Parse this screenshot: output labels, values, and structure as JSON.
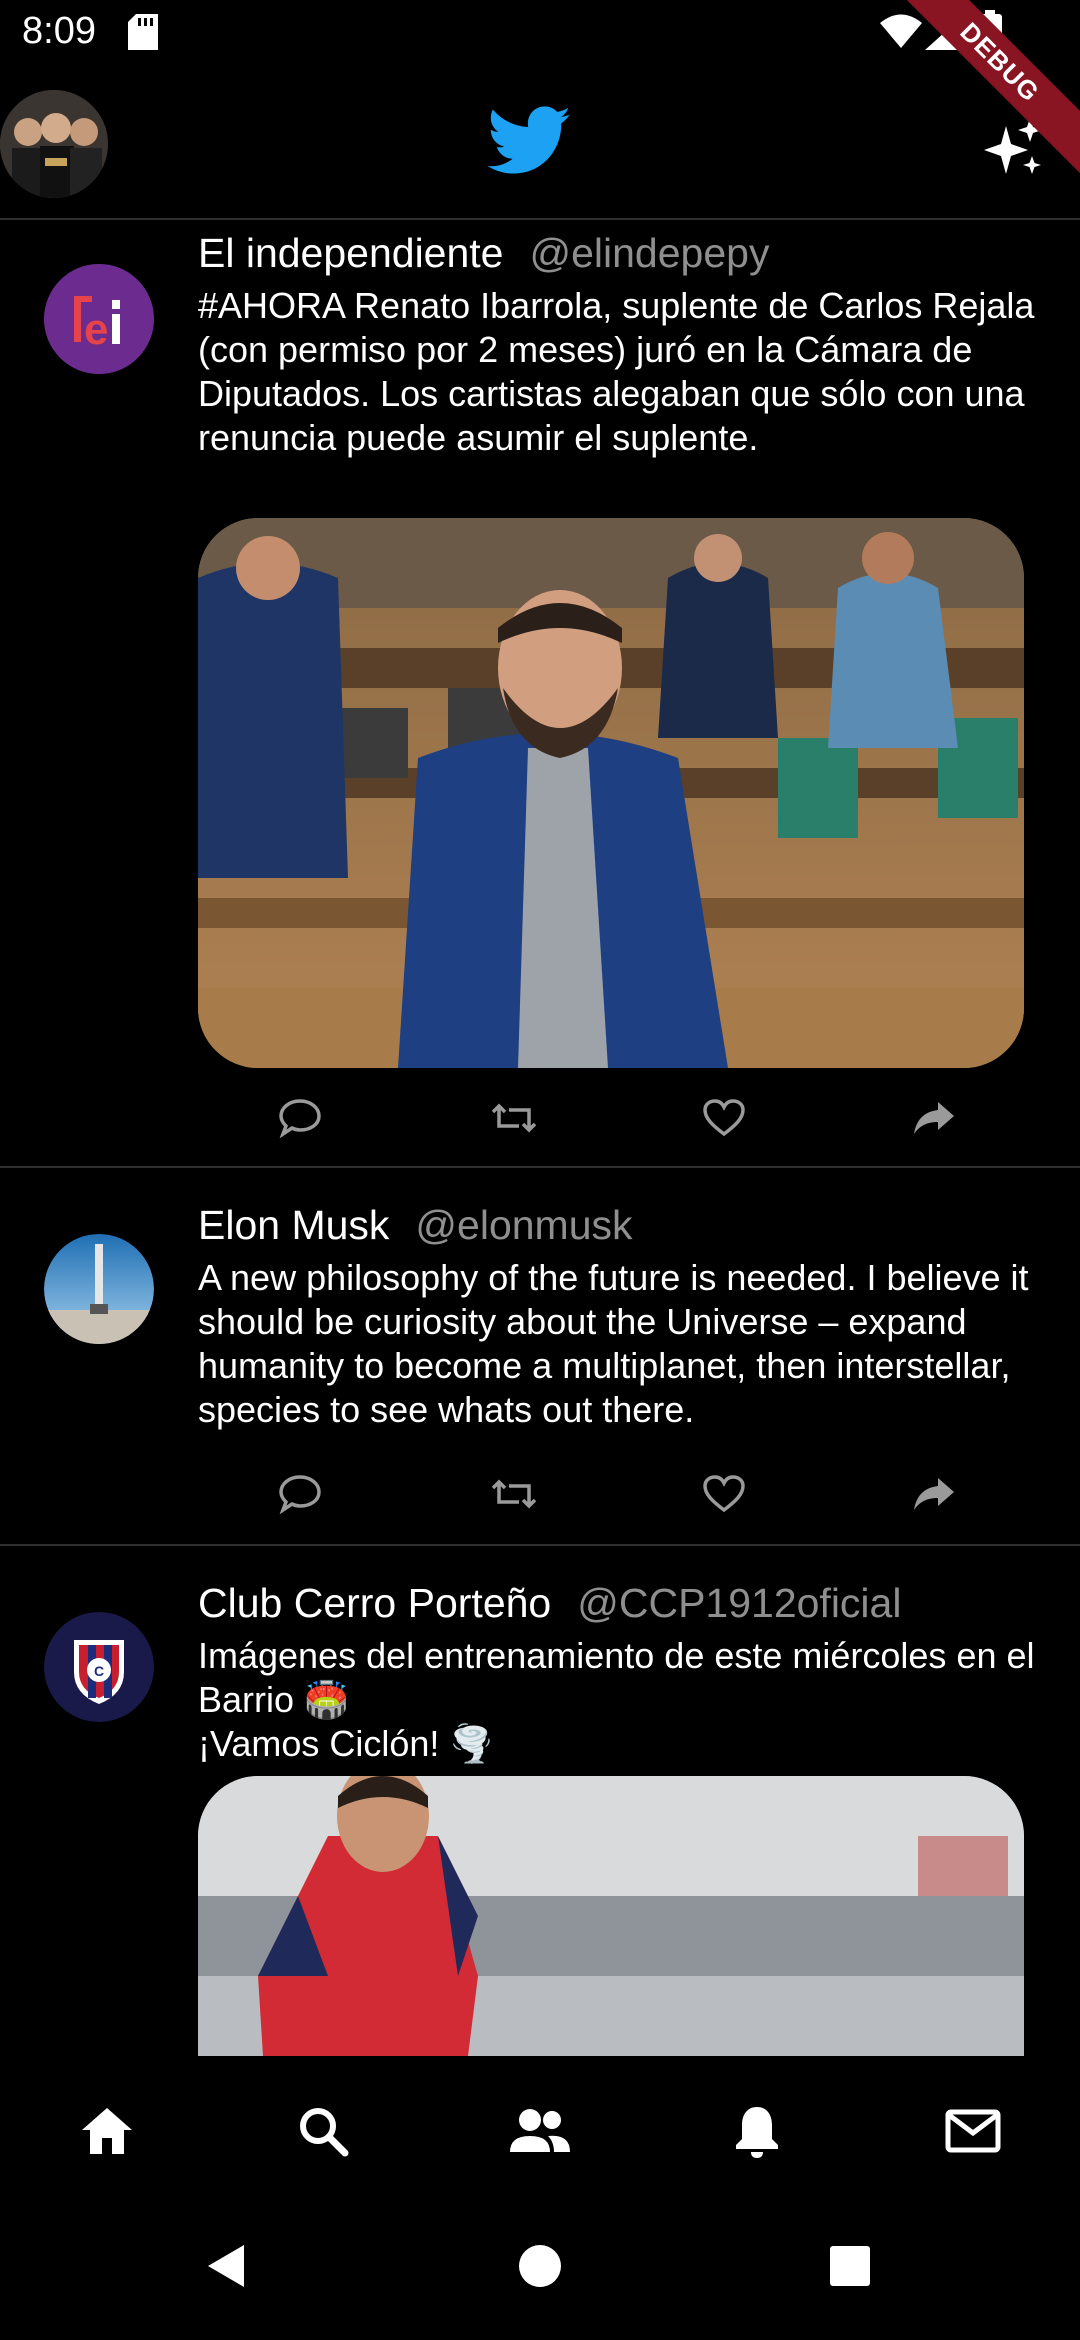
{
  "status_bar": {
    "time": "8:09",
    "icons": [
      "sd-card-icon",
      "wifi-icon",
      "signal-icon",
      "battery-icon"
    ]
  },
  "debug_banner": "DEBUG",
  "app_bar": {
    "logo": "twitter-bird-icon",
    "right_icon": "sparkle-icon",
    "brand_color": "#1DA1F2"
  },
  "tweets": [
    {
      "name": "El independiente",
      "handle": "@elindepepy",
      "text": "#AHORA Renato Ibarrola, suplente de Carlos Rejala (con permiso por 2 meses) juró en la Cámara de Diputados. Los cartistas alegaban que sólo con una renuncia puede asumir el suplente.",
      "avatar_text": "ei",
      "has_media": true
    },
    {
      "name": "Elon Musk",
      "handle": "@elonmusk",
      "text": "A new philosophy of the future is needed. I believe it should be curiosity about the Universe – expand humanity to become a multiplanet, then interstellar, species to see whats out there.",
      "has_media": false
    },
    {
      "name": "Club Cerro Porteño",
      "handle": "@CCP1912oficial",
      "text": "Imágenes del entrenamiento de este miércoles en el Barrio 🏟️\n ¡Vamos Ciclón! 🌪️",
      "has_media": true
    }
  ],
  "tweet_actions": [
    "reply-icon",
    "retweet-icon",
    "like-icon",
    "share-icon"
  ],
  "bottom_nav": [
    "home-icon",
    "search-icon",
    "people-icon",
    "notifications-icon",
    "messages-icon"
  ],
  "system_nav": [
    "back-icon",
    "home-circle-icon",
    "recents-icon"
  ]
}
